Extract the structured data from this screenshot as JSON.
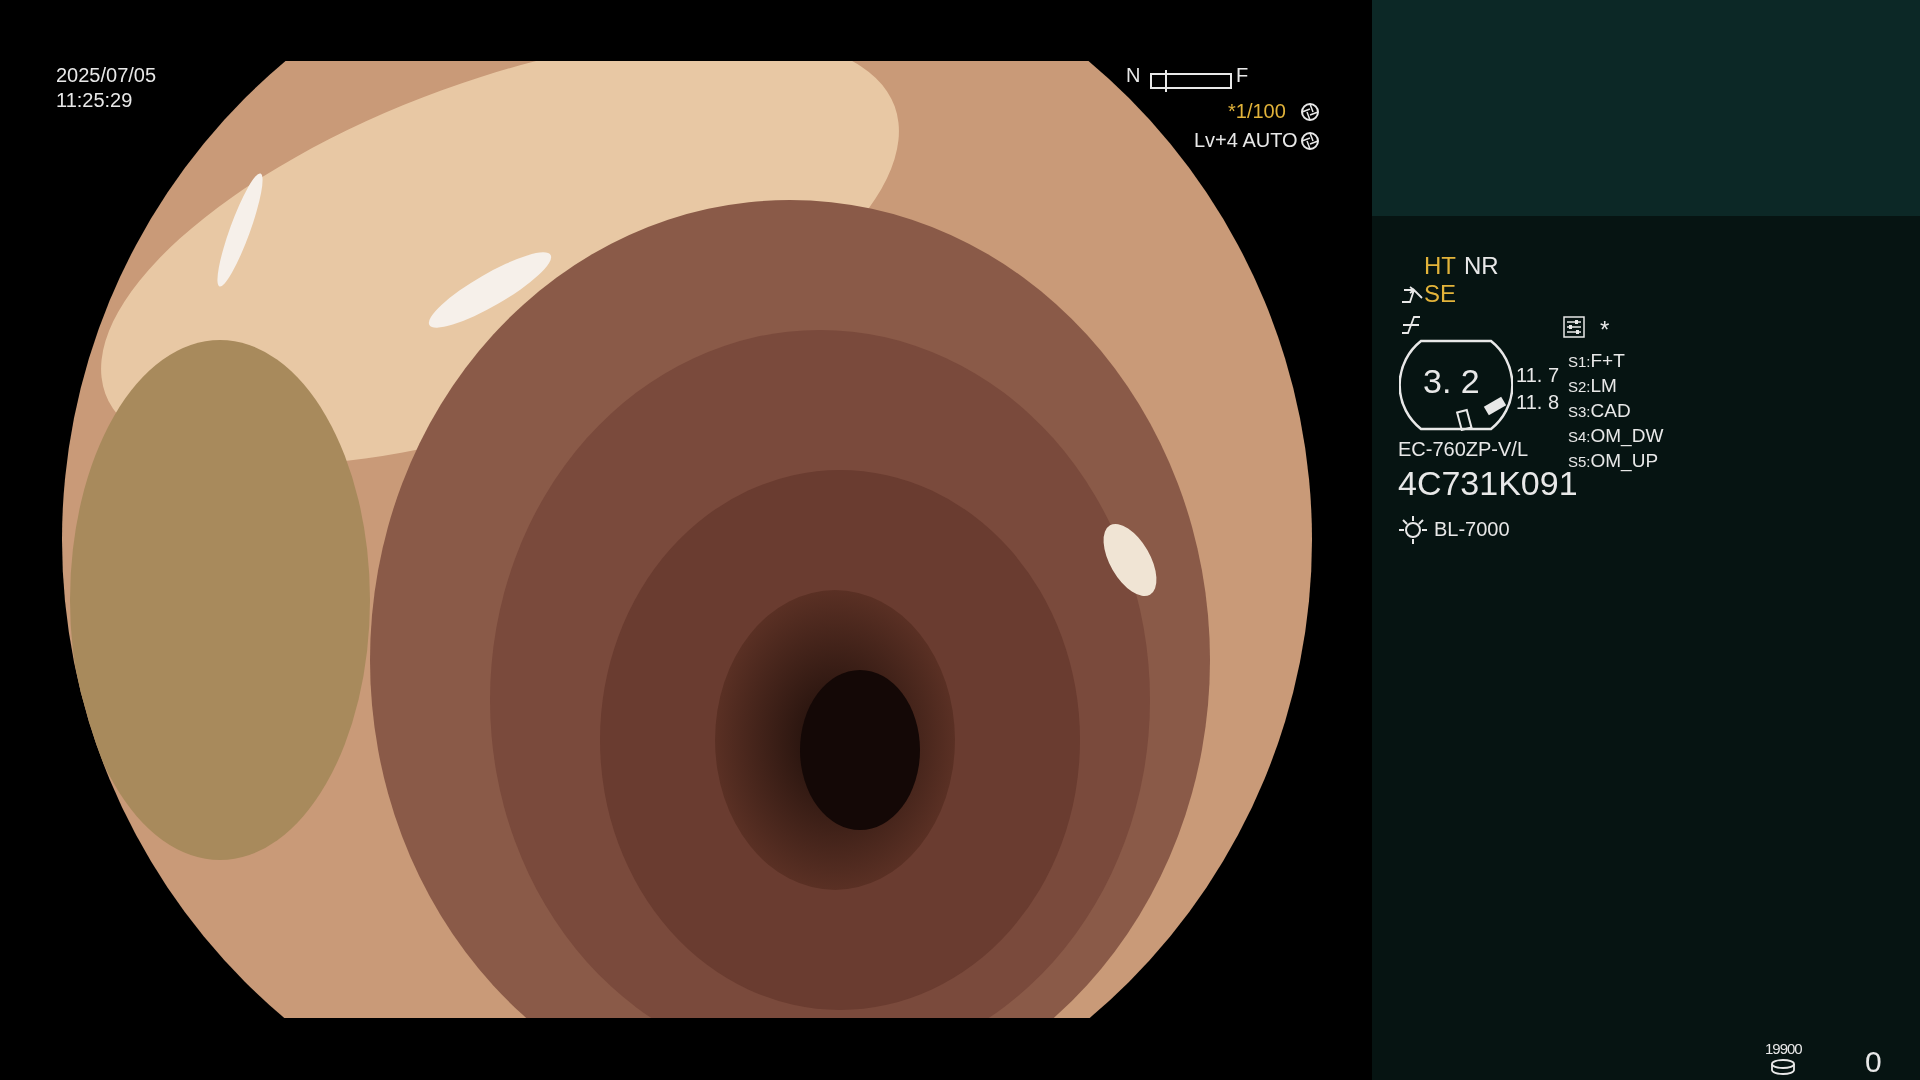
{
  "timestamp": {
    "date": "2025/07/05",
    "time": "11:25:29"
  },
  "zoom": {
    "near_label": "N",
    "far_label": "F",
    "level": 0.17
  },
  "shutter": {
    "text": "*1/100",
    "on": true
  },
  "iris": {
    "text": "Lv+4 AUTO"
  },
  "side_panel": {
    "modes": [
      {
        "label": "HT",
        "on": true
      },
      {
        "label": "NR",
        "on": false
      }
    ],
    "enhancement": {
      "label": "SE",
      "on": true
    },
    "asterisk": "*",
    "scope_badge": "3. 2",
    "readings": [
      "11. 7",
      "11. 8"
    ],
    "switches": [
      {
        "key": "S1:",
        "value": "F+T"
      },
      {
        "key": "S2:",
        "value": "LM"
      },
      {
        "key": "S3:",
        "value": "CAD"
      },
      {
        "key": "S4:",
        "value": "OM_DW"
      },
      {
        "key": "S5:",
        "value": "OM_UP"
      }
    ],
    "scope_model": "EC-760ZP-V/L",
    "serial": "4C731K091",
    "light_source": "BL-7000",
    "storage_count": "19900",
    "counter": "0"
  }
}
